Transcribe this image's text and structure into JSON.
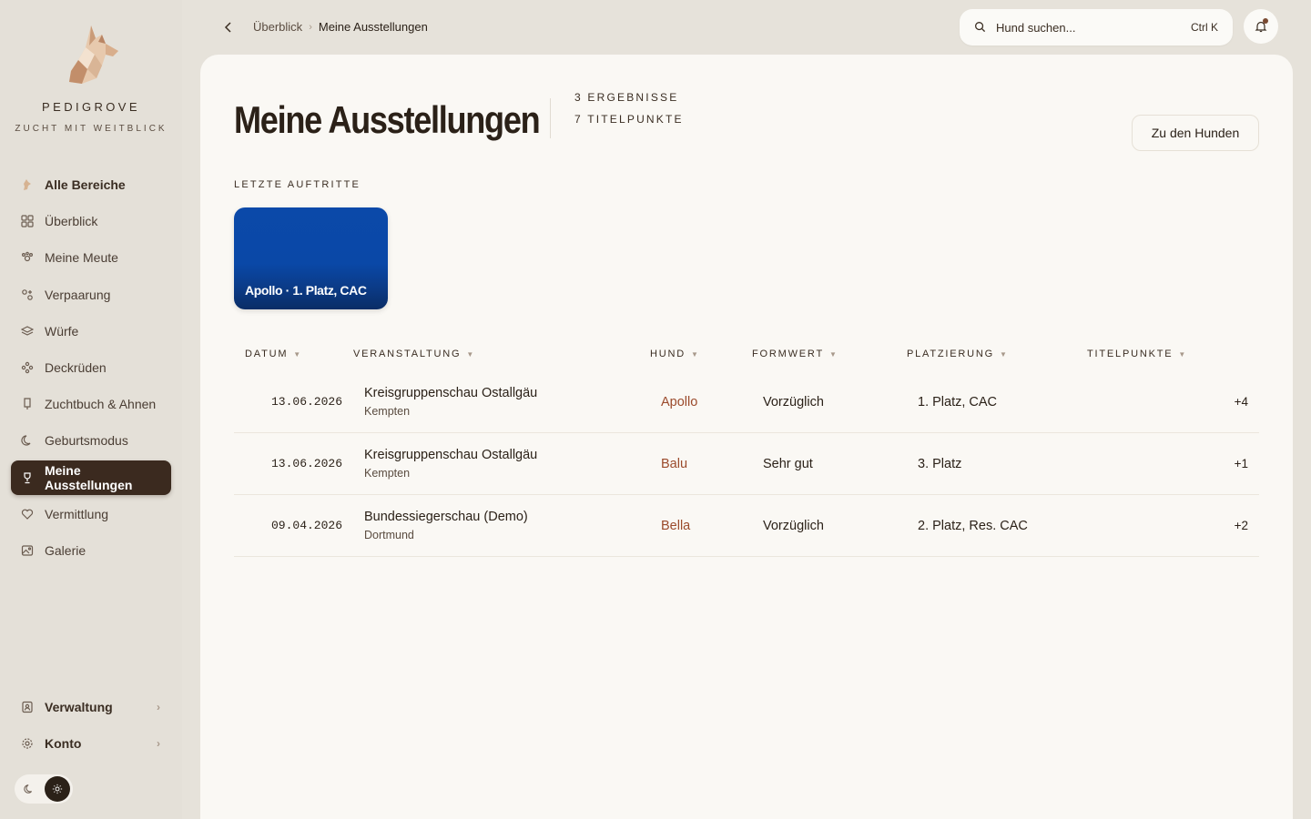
{
  "brand": {
    "name": "PEDIGROVE",
    "tagline": "ZUCHT MIT WEITBLICK"
  },
  "sidebar": {
    "items": [
      {
        "label": "Alle Bereiche",
        "icon": "dog-logo-icon"
      },
      {
        "label": "Überblick",
        "icon": "grid-icon"
      },
      {
        "label": "Meine Meute",
        "icon": "pack-icon"
      },
      {
        "label": "Verpaarung",
        "icon": "pairing-icon"
      },
      {
        "label": "Würfe",
        "icon": "layers-icon"
      },
      {
        "label": "Deckrüden",
        "icon": "stud-icon"
      },
      {
        "label": "Zuchtbuch & Ahnen",
        "icon": "book-icon"
      },
      {
        "label": "Geburtsmodus",
        "icon": "moon-icon"
      },
      {
        "label": "Meine Ausstellungen",
        "icon": "trophy-icon"
      },
      {
        "label": "Vermittlung",
        "icon": "heart-icon"
      },
      {
        "label": "Galerie",
        "icon": "image-icon"
      }
    ],
    "bottom": [
      {
        "label": "Verwaltung",
        "icon": "admin-icon"
      },
      {
        "label": "Konto",
        "icon": "gear-icon"
      }
    ]
  },
  "breadcrumb": {
    "parent": "Überblick",
    "current": "Meine Ausstellungen"
  },
  "search": {
    "placeholder": "Hund suchen...",
    "shortcut": "Ctrl K"
  },
  "page": {
    "title": "Meine Ausstellungen",
    "stats": {
      "results": "3 ERGEBNISSE",
      "points": "7 TITELPUNKTE"
    },
    "action_label": "Zu den Hunden",
    "recent_label": "LETZTE AUFTRITTE",
    "recent_tile": "Apollo · 1. Platz, CAC"
  },
  "table": {
    "headers": {
      "date": "DATUM",
      "event": "VERANSTALTUNG",
      "dog": "HUND",
      "form": "FORMWERT",
      "place": "PLATZIERUNG",
      "points": "TITELPUNKTE"
    },
    "rows": [
      {
        "date": "13.06.2026",
        "event": "Kreisgruppenschau Ostallgäu",
        "location": "Kempten",
        "dog": "Apollo",
        "form": "Vorzüglich",
        "place": "1. Platz, CAC",
        "points": "+4"
      },
      {
        "date": "13.06.2026",
        "event": "Kreisgruppenschau Ostallgäu",
        "location": "Kempten",
        "dog": "Balu",
        "form": "Sehr gut",
        "place": "3. Platz",
        "points": "+1"
      },
      {
        "date": "09.04.2026",
        "event": "Bundessiegerschau (Demo)",
        "location": "Dortmund",
        "dog": "Bella",
        "form": "Vorzüglich",
        "place": "2. Platz, Res. CAC",
        "points": "+2"
      }
    ]
  },
  "colors": {
    "active_nav": "#3b2a1f",
    "accent_dog": "#9b4a2b",
    "tile_blue": "#0b49a9",
    "background": "#e6e2da",
    "card": "#faf8f4"
  }
}
